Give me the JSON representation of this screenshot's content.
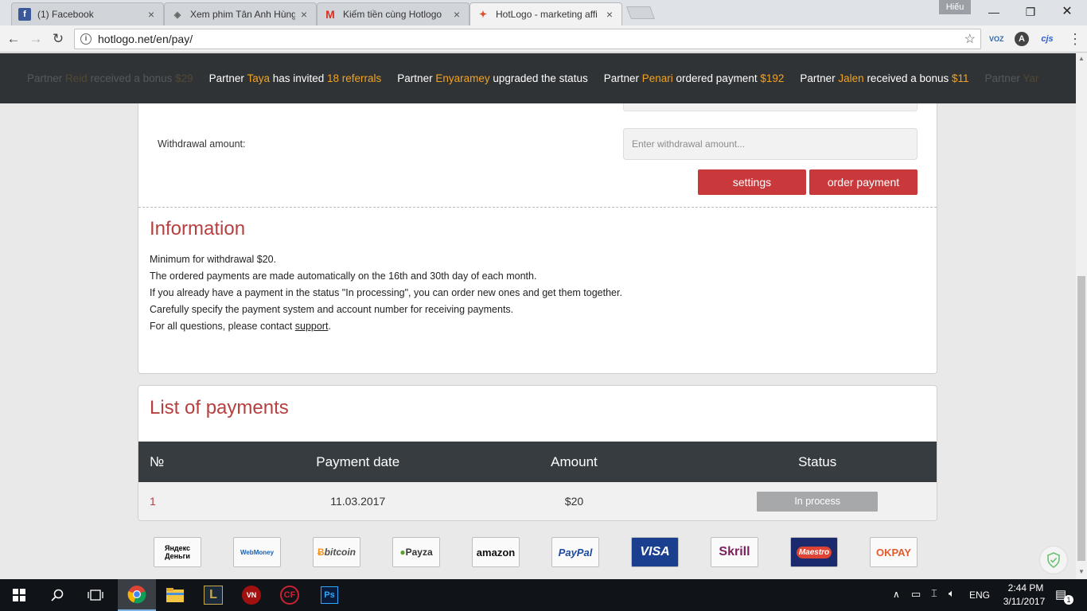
{
  "browser": {
    "tabs": [
      {
        "title": "(1) Facebook",
        "icon": "facebook-icon"
      },
      {
        "title": "Xem phim Tân Anh Hùng",
        "icon": "movie-icon"
      },
      {
        "title": "Kiếm tiền cùng Hotlogo",
        "icon": "gmail-icon"
      },
      {
        "title": "HotLogo - marketing affi",
        "icon": "hotlogo-icon"
      }
    ],
    "tab_close": "×",
    "profile_name": "Hiếu",
    "url": "hotlogo.net/en/pay/",
    "ext_labels": [
      "VOZ",
      "A",
      "cjs"
    ]
  },
  "ticker": [
    {
      "pre": "Partner ",
      "name": "Reid",
      "mid": " received a bonus ",
      "val": "$29",
      "faded": true
    },
    {
      "pre": "Partner ",
      "name": "Taya",
      "mid": " has invited ",
      "val": "18 referrals",
      "faded": false
    },
    {
      "pre": "Partner ",
      "name": "Enyaramey",
      "mid": " upgraded the status",
      "val": "",
      "faded": false
    },
    {
      "pre": "Partner ",
      "name": "Penari",
      "mid": " ordered payment ",
      "val": "$192",
      "faded": false
    },
    {
      "pre": "Partner ",
      "name": "Jalen",
      "mid": " received a bonus ",
      "val": "$11",
      "faded": false
    },
    {
      "pre": "Partner ",
      "name": "Yar",
      "mid": "",
      "val": "",
      "faded": true
    }
  ],
  "withdraw": {
    "label": "Withdrawal amount:",
    "placeholder": "Enter withdrawal amount...",
    "settings_label": "settings",
    "order_label": "order payment"
  },
  "information": {
    "title": "Information",
    "lines": [
      "Minimum for withdrawal $20.",
      "The ordered payments are made automatically on the 16th and 30th day of each month.",
      "If you already have a payment in the status \"In processing\", you can order new ones and get them together.",
      "Carefully specify the payment system and account number for receiving payments."
    ],
    "contact_prefix": "For all questions, please contact ",
    "contact_link": "support",
    "contact_suffix": "."
  },
  "payments": {
    "title": "List of payments",
    "columns": [
      "№",
      "Payment date",
      "Amount",
      "Status"
    ],
    "rows": [
      {
        "num": "1",
        "date": "11.03.2017",
        "amount": "$20",
        "status": "In process"
      }
    ]
  },
  "payment_systems": [
    {
      "label": "Яндекс Деньги",
      "icon": "yandex-money-logo",
      "color": "#e1461e"
    },
    {
      "label": "WebMoney",
      "icon": "webmoney-logo",
      "color": "#1d5fae"
    },
    {
      "label": "bitcoin",
      "icon": "bitcoin-logo",
      "color": "#4d4d4d"
    },
    {
      "label": "Payza",
      "icon": "payza-logo",
      "color": "#333333"
    },
    {
      "label": "amazon",
      "icon": "amazon-logo",
      "color": "#111111"
    },
    {
      "label": "PayPal",
      "icon": "paypal-logo",
      "color": "#1b4aa0"
    },
    {
      "label": "VISA",
      "icon": "visa-electron-logo",
      "color": "#ffffff"
    },
    {
      "label": "Skrill",
      "icon": "skrill-logo",
      "color": "#7a1f5c"
    },
    {
      "label": "Maestro",
      "icon": "maestro-logo",
      "color": "#ffffff"
    },
    {
      "label": "OKPAY",
      "icon": "okpay-logo",
      "color": "#e35a2c"
    }
  ],
  "taskbar": {
    "language": "ENG",
    "time": "2:44 PM",
    "date": "3/11/2017",
    "notifications": "1"
  },
  "colors": {
    "accent_red": "#c9383b",
    "ticker_highlight": "#f4a21d",
    "table_header": "#363c40"
  }
}
